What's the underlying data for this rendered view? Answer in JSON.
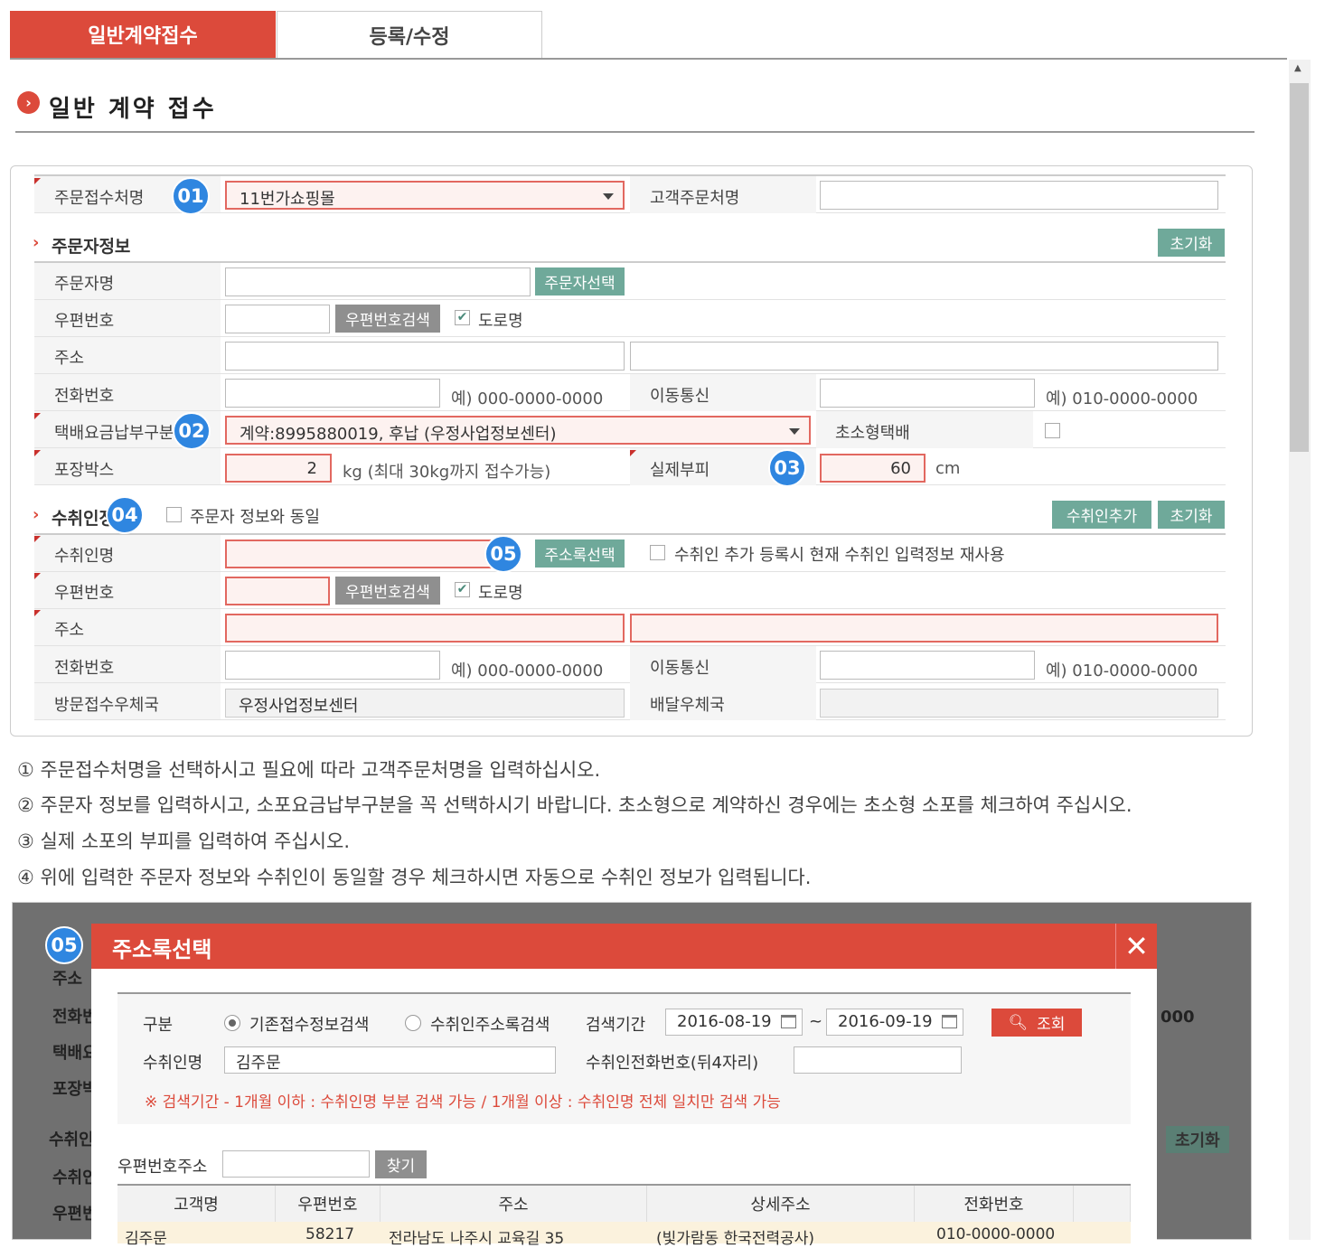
{
  "tabs": [
    {
      "label": "일반계약접수"
    },
    {
      "label": "등록/수정"
    }
  ],
  "page_title": "일반 계약 접수",
  "form": {
    "order_channel": {
      "label": "주문접수처명",
      "value": "11번가쇼핑몰"
    },
    "customer_order": {
      "label": "고객주문처명",
      "value": ""
    },
    "orderer_section": {
      "title": "주문자정보",
      "reset_label": "초기화"
    },
    "orderer_name": {
      "label": "주문자명",
      "button": "주문자선택"
    },
    "orderer_zip": {
      "label": "우편번호",
      "button": "우편번호검색",
      "road_label": "도로명"
    },
    "orderer_address": {
      "label": "주소"
    },
    "orderer_phone": {
      "label": "전화번호",
      "hint": "예) 000-0000-0000"
    },
    "orderer_mobile": {
      "label": "이동통신",
      "hint": "예) 010-0000-0000"
    },
    "payment_type": {
      "label": "택배요금납부구분",
      "value": "계약:8995880019, 후납 (우정사업정보센터)"
    },
    "small_parcel": {
      "label": "초소형택배"
    },
    "box": {
      "label": "포장박스",
      "value": "2",
      "hint": "kg (최대 30kg까지 접수가능)"
    },
    "volume": {
      "label": "실제부피",
      "value": "60",
      "unit": "cm"
    },
    "receiver_section": {
      "title": "수취인정",
      "same_label": "주문자 정보와 동일",
      "add_label": "수취인추가",
      "reset_label": "초기화"
    },
    "receiver_name": {
      "label": "수취인명",
      "button": "주소록선택",
      "reuse_label": "수취인 추가 등록시 현재 수취인 입력정보 재사용"
    },
    "receiver_zip": {
      "label": "우편번호",
      "button": "우편번호검색",
      "road_label": "도로명"
    },
    "receiver_address": {
      "label": "주소"
    },
    "receiver_phone": {
      "label": "전화번호",
      "hint": "예) 000-0000-0000"
    },
    "receiver_mobile": {
      "label": "이동통신",
      "hint": "예) 010-0000-0000"
    },
    "visit_office": {
      "label": "방문접수우체국",
      "value": "우정사업정보센터"
    },
    "delivery_office": {
      "label": "배달우체국",
      "value": ""
    }
  },
  "badges": [
    "01",
    "02",
    "03",
    "04",
    "05"
  ],
  "notes": [
    "① 주문접수처명을 선택하시고 필요에 따라 고객주문처명을 입력하십시오.",
    "② 주문자 정보를 입력하시고, 소포요금납부구분을 꼭 선택하시기 바랍니다. 초소형으로 계약하신 경우에는 초소형 소포를 체크하여 주십시오.",
    "③ 실제 소포의 부피를 입력하여 주십시오.",
    "④ 위에 입력한 주문자 정보와 수취인이 동일할 경우 체크하시면 자동으로 수취인 정보가 입력됩니다."
  ],
  "dialog": {
    "badge": "05",
    "title": "주소록선택",
    "type_label": "구분",
    "radio1": "기존접수정보검색",
    "radio2": "수취인주소록검색",
    "period_label": "검색기간",
    "date_from": "2016-08-19",
    "date_sep": "~",
    "date_to": "2016-09-19",
    "search_button": "조회",
    "receiver_label": "수취인명",
    "receiver_value": "김주문",
    "phone4_label": "수취인전화번호(뒤4자리)",
    "warning": "※ 검색기간 - 1개월 이하 : 수취인명 부분 검색 가능 / 1개월 이상 : 수취인명 전체 일치만 검색 가능",
    "zip_label": "우편번호주소",
    "find_button": "찾기",
    "columns": [
      "고객명",
      "우편번호",
      "주소",
      "상세주소",
      "전화번호"
    ],
    "row": [
      "김주문",
      "58217",
      "전라남도 나주시 교육길 35",
      "(빛가람동 한국전력공사)",
      "010-0000-0000"
    ]
  },
  "background_fragments": [
    "주소",
    "전화번",
    "택배요",
    "포장박",
    "수취인",
    "수취인",
    "우편번",
    "000",
    "초기화"
  ]
}
